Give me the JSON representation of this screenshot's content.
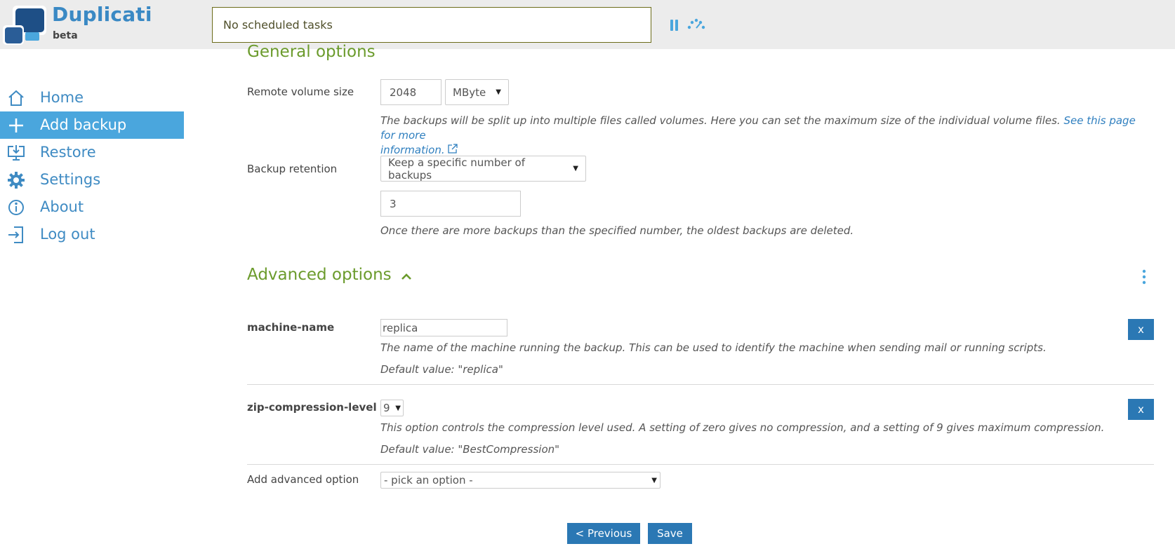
{
  "header": {
    "brand_name": "Duplicati",
    "brand_sub": "beta",
    "status_text": "No scheduled tasks"
  },
  "sidebar": {
    "items": [
      {
        "label": "Home",
        "icon": "home-icon",
        "active": false
      },
      {
        "label": "Add backup",
        "icon": "plus-icon",
        "active": true
      },
      {
        "label": "Restore",
        "icon": "restore-icon",
        "active": false
      },
      {
        "label": "Settings",
        "icon": "gear-icon",
        "active": false
      },
      {
        "label": "About",
        "icon": "info-icon",
        "active": false
      },
      {
        "label": "Log out",
        "icon": "logout-icon",
        "active": false
      }
    ]
  },
  "general": {
    "title": "General options",
    "volume_label": "Remote volume size",
    "volume_value": "2048",
    "volume_unit": "MByte",
    "volume_help": "The backups will be split up into multiple files called volumes. Here you can set the maximum size of the individual volume files.",
    "volume_link_line1": "See this page for more",
    "volume_link_line2": "information.",
    "retention_label": "Backup retention",
    "retention_value": "Keep a specific number of backups",
    "retention_count": "3",
    "retention_help": "Once there are more backups than the specified number, the oldest backups are deleted."
  },
  "advanced": {
    "title": "Advanced options",
    "options": [
      {
        "name": "machine-name",
        "value": "replica",
        "help": "The name of the machine running the backup. This can be used to identify the machine when sending mail or running scripts.",
        "default": "Default value: \"replica\"",
        "remove_label": "x"
      },
      {
        "name": "zip-compression-level",
        "value": "9",
        "help": "This option controls the compression level used. A setting of zero gives no compression, and a setting of 9 gives maximum compression.",
        "default": "Default value: \"BestCompression\"",
        "remove_label": "x"
      }
    ],
    "add_label": "Add advanced option",
    "add_placeholder": "- pick an option -"
  },
  "footer": {
    "previous_label": "< Previous",
    "save_label": "Save"
  },
  "colors": {
    "accent": "#4aa6dd",
    "link": "#3f8bc3",
    "section_title": "#6b9b2c",
    "button": "#2b78b4"
  }
}
